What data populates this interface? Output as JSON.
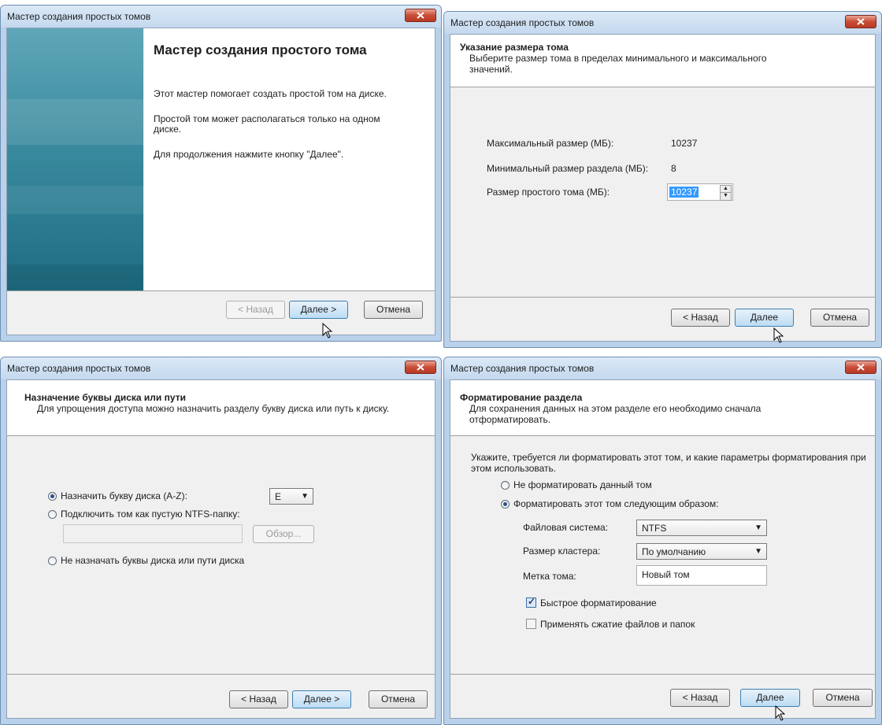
{
  "dialogs": {
    "welcome": {
      "title": "Мастер создания простых томов",
      "heading": "Мастер создания простого тома",
      "para1": "Этот мастер помогает создать простой том на диске.",
      "para2": "Простой том может располагаться только на одном диске.",
      "para3": "Для продолжения нажмите кнопку \"Далее\".",
      "back": "< Назад",
      "next": "Далее >",
      "cancel": "Отмена"
    },
    "size": {
      "title": "Мастер создания простых томов",
      "header_title": "Указание размера тома",
      "header_sub": "Выберите размер тома в пределах минимального и максимального значений.",
      "max_label": "Максимальный размер (МБ):",
      "max_value": "10237",
      "min_label": "Минимальный размер раздела (МБ):",
      "min_value": "8",
      "size_label": "Размер простого тома (МБ):",
      "size_value": "10237",
      "back": "< Назад",
      "next": "Далее",
      "cancel": "Отмена"
    },
    "letter": {
      "title": "Мастер создания простых томов",
      "header_title": "Назначение буквы диска или пути",
      "header_sub": "Для упрощения доступа можно назначить разделу букву диска или путь к диску.",
      "opt_assign": "Назначить букву диска (A-Z):",
      "drive_letter": "E",
      "opt_mount": "Подключить том как пустую NTFS-папку:",
      "browse": "Обзор...",
      "opt_none": "Не назначать буквы диска или пути диска",
      "back": "< Назад",
      "next": "Далее >",
      "cancel": "Отмена"
    },
    "format": {
      "title": "Мастер создания простых томов",
      "header_title": "Форматирование раздела",
      "header_sub": "Для сохранения данных на этом разделе его необходимо сначала отформатировать.",
      "intro": "Укажите, требуется ли форматировать этот том, и какие параметры форматирования при этом использовать.",
      "opt_noformat": "Не форматировать данный том",
      "opt_format": "Форматировать этот том следующим образом:",
      "fs_label": "Файловая система:",
      "fs_value": "NTFS",
      "cluster_label": "Размер кластера:",
      "cluster_value": "По умолчанию",
      "vol_label": "Метка тома:",
      "vol_value": "Новый том",
      "quick_format": "Быстрое форматирование",
      "compress": "Применять сжатие файлов и папок",
      "back": "< Назад",
      "next": "Далее",
      "cancel": "Отмена"
    }
  },
  "colors": {
    "accent": "#3399ff",
    "frame": "#b9d1ea",
    "close": "#c94c36"
  },
  "icons": [
    "close-icon",
    "cursor-icon",
    "chevron-down-icon",
    "spinner-up-icon",
    "spinner-down-icon"
  ]
}
